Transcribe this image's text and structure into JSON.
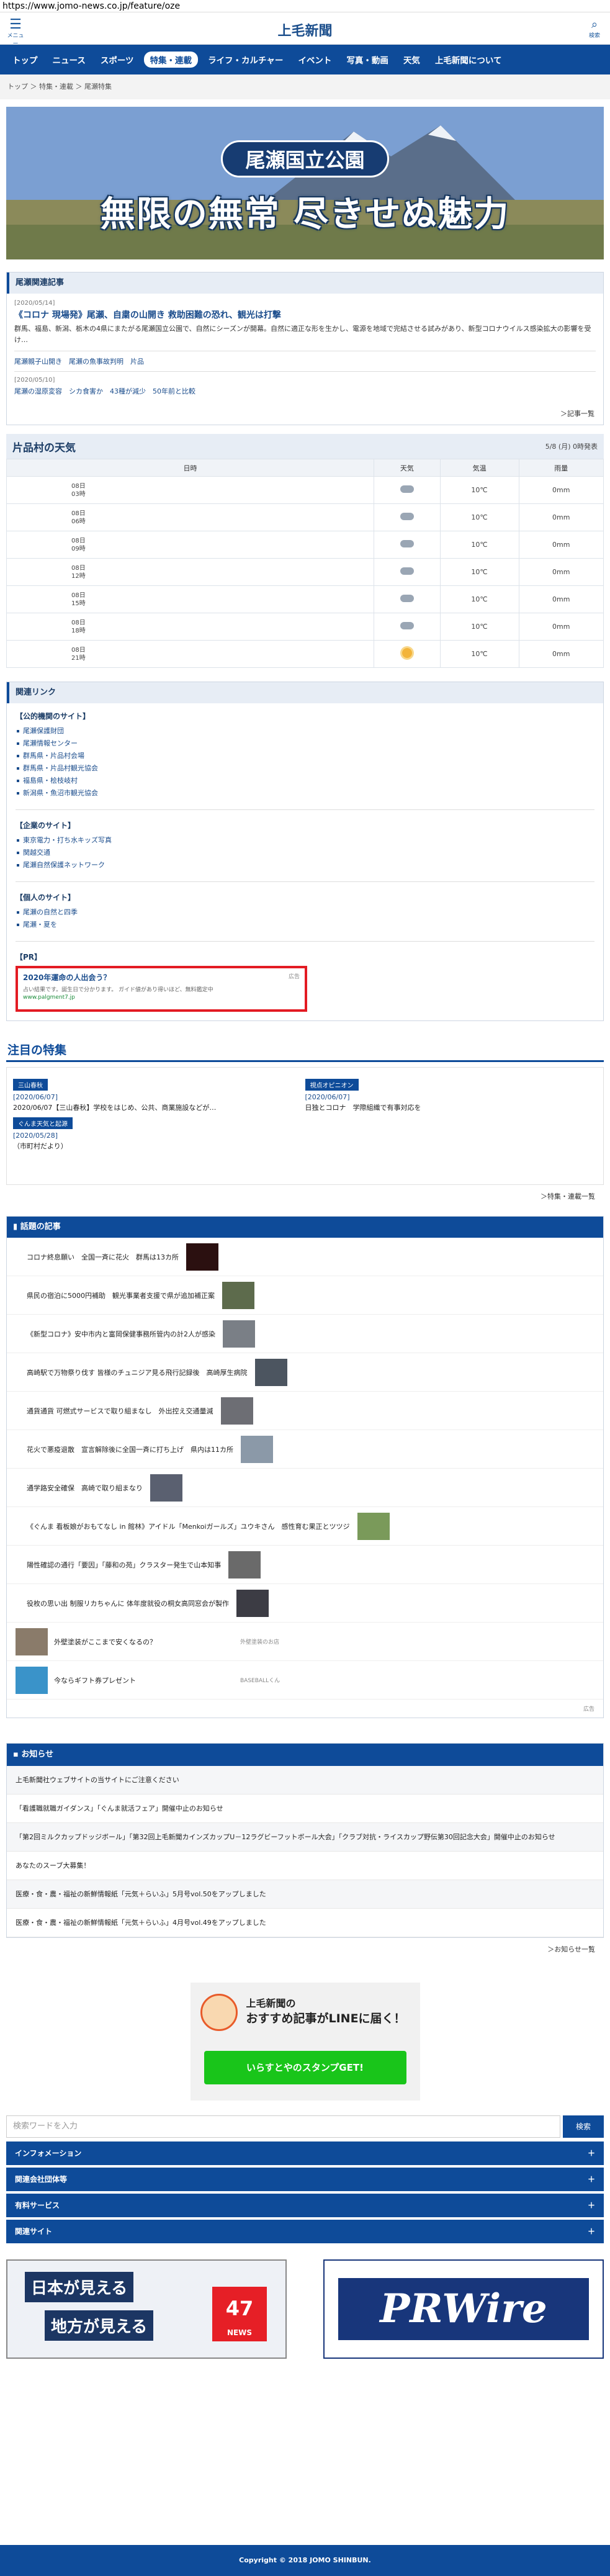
{
  "url": "https://www.jomo-news.co.jp/feature/oze",
  "header": {
    "menu_label": "メニュー",
    "logo": "上毛新聞",
    "search_label": "検索"
  },
  "nav": [
    "トップ",
    "ニュース",
    "スポーツ",
    "特集・連載",
    "ライフ・カルチャー",
    "イベント",
    "写真・動画",
    "天気",
    "上毛新聞について"
  ],
  "breadcrumb": "トップ ＞ 特集・連載 ＞ 尾瀬特集",
  "banner": {
    "subtitle": "尾瀬国立公園",
    "title": "無限の無常 尽きせぬ魅力"
  },
  "related": {
    "heading": "尾瀬関連記事",
    "date1": "[2020/05/14]",
    "title1": "《コロナ 現場発》尾瀬、自粛の山開き 救助困難の恐れ、観光は打撃",
    "desc1": "群馬、福島、新潟、栃木の4県にまたがる尾瀬国立公園で、自然にシーズンが開幕。自然に適正な形を生かし、電源を地域で完結させる試みがあり、新型コロナウイルス感染拡大の影響を受け…",
    "links1": "尾瀬親子山開き　尾瀬の魚事故判明　片品",
    "date2": "[2020/05/10]",
    "links2": "尾瀬の湿原変容　シカ食害か　43種が減少　50年前と比較",
    "more": "＞記事一覧"
  },
  "weather": {
    "title": "片品村の天気",
    "updated": "5/8 (月) 0時発表",
    "headers": [
      "日時",
      "天気",
      "気温",
      "雨量"
    ],
    "rows": [
      {
        "date": "08日",
        "time": "03時",
        "temp": "10℃",
        "rain": "0mm",
        "icon": "cloud"
      },
      {
        "date": "08日",
        "time": "06時",
        "temp": "10℃",
        "rain": "0mm",
        "icon": "cloud"
      },
      {
        "date": "08日",
        "time": "09時",
        "temp": "10℃",
        "rain": "0mm",
        "icon": "cloud"
      },
      {
        "date": "08日",
        "time": "12時",
        "temp": "10℃",
        "rain": "0mm",
        "icon": "cloud"
      },
      {
        "date": "08日",
        "time": "15時",
        "temp": "10℃",
        "rain": "0mm",
        "icon": "cloud"
      },
      {
        "date": "08日",
        "time": "18時",
        "temp": "10℃",
        "rain": "0mm",
        "icon": "cloud"
      },
      {
        "date": "08日",
        "time": "21時",
        "temp": "10℃",
        "rain": "0mm",
        "icon": "sun"
      }
    ]
  },
  "links": {
    "heading": "関連リンク",
    "public_title": "【公的機関のサイト】",
    "public": [
      "尾瀬保護財団",
      "尾瀬情報センター",
      "群馬県・片品村会場",
      "群馬県・片品村観光協会",
      "福島県・桧枝岐村",
      "新潟県・魚沼市観光協会"
    ],
    "company_title": "【企業のサイト】",
    "company": [
      "東京電力・打ち水キッズ写真",
      "関越交通",
      "尾瀬自然保護ネットワーク"
    ],
    "personal_title": "【個人のサイト】",
    "personal": [
      "尾瀬の自然と四季",
      "尾瀬・夏を"
    ],
    "pr_title": "【PR】",
    "pr_ad_title": "2020年運命の人出会う？",
    "pr_ad_desc": "占い結果です。誕生日で分かります。 ガイド値があり得いほど、無料鑑定中",
    "pr_ad_url": "www.palgment7.jp",
    "pr_ad_mark": "広告"
  },
  "feature": {
    "heading": "注目の特集",
    "items": [
      {
        "tag": "三山春秋",
        "date": "[2020/06/07]",
        "title": "2020/06/07【三山春秋】学校をはじめ、公共、商業施設などが…"
      },
      {
        "tag": "視点オピニオン",
        "date": "[2020/06/07]",
        "title": "日独とコロナ　学際組織で有事対応を"
      },
      {
        "tag": "ぐんま天気と起源",
        "date": "[2020/05/28]",
        "title": "（市町村だより）"
      }
    ],
    "more": "＞特集・連載一覧"
  },
  "hot": {
    "heading": "話題の記事",
    "items": [
      "コロナ終息願い　全国一斉に花火　群馬は13カ所",
      "県民の宿泊に5000円補助　観光事業者支援で県が追加補正案",
      "《新型コロナ》安中市内と富岡保健事務所管内の計2人が感染",
      "高崎駅で万物祭り伐す 皆様のチュニジア見る飛行記録後　高崎厚生病院",
      "通貨通貨 可燃式サービスで取り組まなし　外出控え交通量減",
      "花火で悪疫退散　宣言解除後に全国一斉に打ち上げ　県内は11カ所",
      "通学路安全確保　高崎で取り組まなり",
      "《ぐんま 看板娘がおもてなし in 館林》アイドル「Menkoiガールズ」ユウキさん　感性育む果正とツツジ",
      "陽性確認の通行「要因」「藤和の苑」クラスター発生で山本知事",
      "役枚の思い出 制服リカちゃんに 体年度就役の桐女高同窓会が製作"
    ],
    "ad1": "外壁塗装がここまで安くなるの？",
    "ad1_src": "外壁塗装のお店",
    "ad2": "今ならギフト券プレゼント",
    "ad2_src": "BASEBALLくん",
    "ad_mark": "広告"
  },
  "notice": {
    "heading": "お知らせ",
    "items": [
      "上毛新聞社ウェブサイトの当サイトにご注意ください",
      "「看護職就職ガイダンス」「ぐんま就活フェア」開催中止のお知らせ",
      "「第2回ミルクカップドッジボール」「第32回上毛新聞カインズカップU－12ラグビーフットボール大会」「クラブ対抗・ライスカップ野伝第30回記念大会」開催中止のお知らせ",
      "あなたのスーブ大募集！",
      "医療・食・農・福祉の新鮮情報紙「元気＋らいふ」5月号vol.50をアップしました",
      "医療・食・農・福祉の新鮮情報紙「元気＋らいふ」4月号vol.49をアップしました"
    ],
    "more": "＞お知らせ一覧"
  },
  "line": {
    "brand": "上毛新聞の",
    "title": "おすすめ記事がLINEに届く！",
    "button": "いらすとやのスタンプGET!"
  },
  "search": {
    "placeholder": "検索ワードを入力",
    "button": "検索"
  },
  "accordion": [
    "インフォメーション",
    "関連会社団体等",
    "有料サービス",
    "関連サイト"
  ],
  "ads": {
    "ad1_line1": "日本が見える",
    "ad1_line2": "地方が見える",
    "ad1_num": "47",
    "ad1_news": "NEWS",
    "ad2": "PRWire"
  },
  "footer": "Copyright © 2018 JOMO SHINBUN."
}
